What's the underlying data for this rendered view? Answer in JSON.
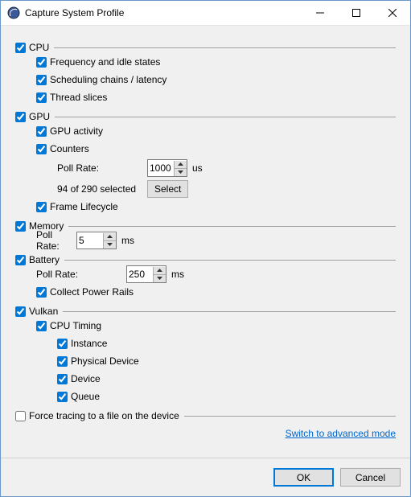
{
  "window": {
    "title": "Capture System Profile",
    "min": "minimize-icon",
    "max": "maximize-icon",
    "close": "close-icon"
  },
  "cpu": {
    "label": "CPU",
    "freq": "Frequency and idle states",
    "sched": "Scheduling chains / latency",
    "thread": "Thread slices"
  },
  "gpu": {
    "label": "GPU",
    "activity": "GPU activity",
    "counters": "Counters",
    "poll_label": "Poll Rate:",
    "poll_value": "1000",
    "poll_unit": "us",
    "selected_text": "94 of 290 selected",
    "select_btn": "Select",
    "frame": "Frame Lifecycle"
  },
  "memory": {
    "label": "Memory",
    "poll_label": "Poll Rate:",
    "poll_value": "5",
    "poll_unit": "ms"
  },
  "battery": {
    "label": "Battery",
    "poll_label": "Poll Rate:",
    "poll_value": "250",
    "poll_unit": "ms",
    "rails": "Collect Power Rails"
  },
  "vulkan": {
    "label": "Vulkan",
    "cpu_timing": "CPU Timing",
    "instance": "Instance",
    "physical": "Physical Device",
    "device": "Device",
    "queue": "Queue"
  },
  "force": {
    "label": "Force tracing to a file on the device"
  },
  "advanced_link": "Switch to advanced mode",
  "buttons": {
    "ok": "OK",
    "cancel": "Cancel"
  }
}
